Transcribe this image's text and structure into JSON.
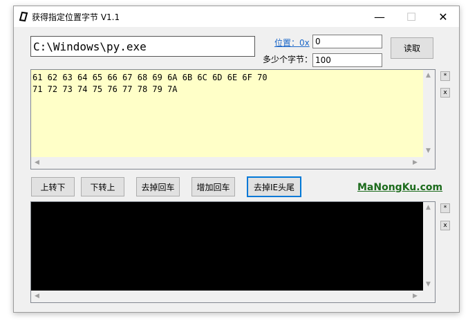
{
  "window": {
    "title": "获得指定位置字节 V1.1",
    "minimize_glyph": "—",
    "maximize_glyph": "☐",
    "close_glyph": "✕"
  },
  "file": {
    "path": "C:\\Windows\\py.exe"
  },
  "position": {
    "label": "位置：0x",
    "value": "0"
  },
  "count": {
    "label": "多少个字节：",
    "value": "100"
  },
  "read_button": "读取",
  "hex_output": {
    "lines": [
      "61 62 63 64 65 66 67 68 69 6A 6B 6C 6D 6E 6F 70",
      "71 72 73 74 75 76 77 78 79 7A"
    ],
    "background": "#ffffc8"
  },
  "side_buttons": {
    "star": "*",
    "clear": "x"
  },
  "actions": {
    "line_to_col": "上转下",
    "col_to_line": "下转上",
    "remove_newlines": "去掉回车",
    "add_newlines": "增加回车",
    "remove_head_tail": "去掉IE头尾"
  },
  "brand": {
    "text": "MaNongKu.com",
    "color": "#1c6b1c"
  },
  "result_output": {
    "lines": [],
    "background": "#000000"
  },
  "icons": {
    "app": "app-icon",
    "scroll_up": "▲",
    "scroll_down": "▼",
    "scroll_left": "◀",
    "scroll_right": "▶"
  }
}
